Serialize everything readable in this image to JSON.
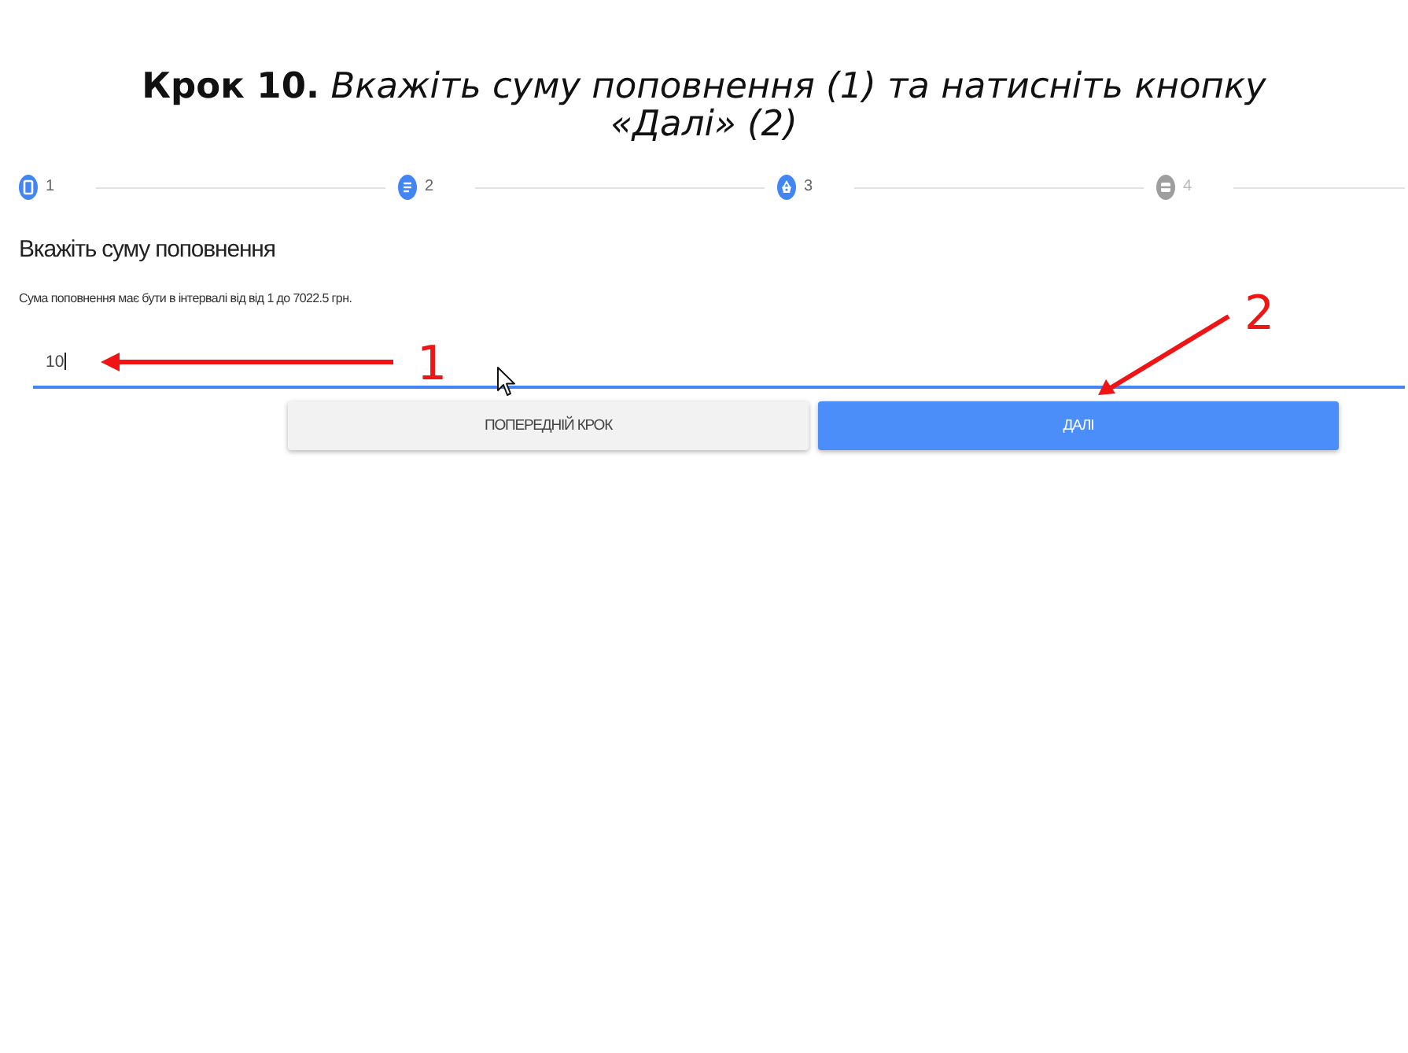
{
  "instruction": {
    "text": "**Крок 10.** *Вкажіть суму поповнення (1) та натисніть кнопку «Далі» (2)*"
  },
  "stepper": {
    "steps": [
      {
        "label": "1",
        "kind": "device",
        "active": true
      },
      {
        "label": "2",
        "kind": "list",
        "active": true
      },
      {
        "label": "3",
        "kind": "basket",
        "active": true
      },
      {
        "label": "4",
        "kind": "card",
        "active": false
      }
    ]
  },
  "form": {
    "heading": "Вкажіть суму поповнення",
    "hint": "Сума поповнення має бути в інтервалі від від 1 до 7022.5 грн.",
    "amount": {
      "value": "10",
      "focused": true
    },
    "buttons": [
      {
        "label": "ПОПЕРЕДНІЙ КРОК",
        "kind": "secondary"
      },
      {
        "label": "ДАЛІ",
        "kind": "primary"
      }
    ]
  },
  "annotations": [
    {
      "label": "1"
    },
    {
      "label": "2"
    }
  ]
}
